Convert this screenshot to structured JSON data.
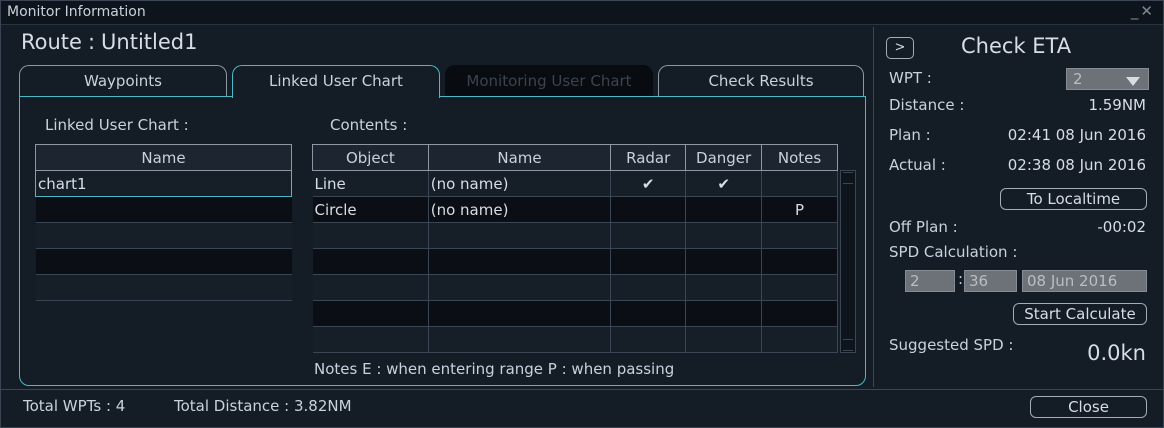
{
  "window": {
    "title": "Monitor Information",
    "controls": "_✕"
  },
  "route": {
    "label": "Route",
    "name": "Untitled1"
  },
  "tabs": [
    {
      "label": "Waypoints",
      "state": "normal"
    },
    {
      "label": "Linked User Chart",
      "state": "active"
    },
    {
      "label": "Monitoring User Chart",
      "state": "disabled"
    },
    {
      "label": "Check Results",
      "state": "normal"
    }
  ],
  "linked": {
    "label": "Linked User Chart :",
    "header": "Name",
    "rows": [
      "chart1",
      "",
      "",
      "",
      ""
    ]
  },
  "contents": {
    "label": "Contents :",
    "headers": [
      "Object",
      "Name",
      "Radar",
      "Danger",
      "Notes"
    ],
    "rows": [
      [
        "Line",
        "(no name)",
        "✔",
        "✔",
        ""
      ],
      [
        "Circle",
        "(no name)",
        "",
        "",
        "P"
      ],
      [
        "",
        "",
        "",
        "",
        ""
      ],
      [
        "",
        "",
        "",
        "",
        ""
      ],
      [
        "",
        "",
        "",
        "",
        ""
      ],
      [
        "",
        "",
        "",
        "",
        ""
      ],
      [
        "",
        "",
        "",
        "",
        ""
      ]
    ],
    "notes": "Notes  E : when entering range  P : when passing"
  },
  "eta": {
    "toggle": ">",
    "title": "Check ETA",
    "wpt_label": "WPT :",
    "wpt_value": "2",
    "distance_label": "Distance :",
    "distance_value": "1.59NM",
    "plan_label": "Plan :",
    "plan_value": "02:41 08 Jun 2016",
    "actual_label": "Actual :",
    "actual_value": "02:38 08 Jun 2016",
    "localtime_button": "To Localtime",
    "offplan_label": "Off Plan :",
    "offplan_value": "-00:02",
    "spd_label": "SPD Calculation :",
    "spd_hour": "2",
    "spd_sep": ":",
    "spd_min": "36",
    "spd_date": "08 Jun 2016",
    "start_button": "Start Calculate",
    "suggested_label": "Suggested SPD :",
    "suggested_value": "0.0kn"
  },
  "footer": {
    "total_wpts": "Total WPTs : 4",
    "total_distance": "Total Distance : 3.82NM",
    "close": "Close"
  }
}
